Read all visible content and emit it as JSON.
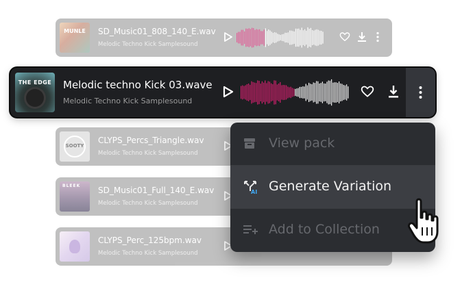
{
  "rows": [
    {
      "title": "SD_Music01_808_140_E.wav",
      "subtitle": "Melodic Techno Kick Samplesound",
      "art_text": "MUNLE"
    },
    {
      "title": "CLYPS_Percs_Triangle.wav",
      "subtitle": "Melodic Techno Kick Samplesound",
      "art_text": "SOOTY"
    },
    {
      "title": "SD_Music01_Full_140_E.wav",
      "subtitle": "Melodic Techno Kick Samplesound",
      "art_text": "BLEEK"
    },
    {
      "title": "CLYPS_Perc_125bpm.wav",
      "subtitle": "Melodic Techno Kick Samplesound",
      "art_text": ""
    }
  ],
  "active_row": {
    "title": "Melodic techno Kick 03.wave",
    "subtitle": "Melodic Techno Kick Samplesound",
    "art_text": "THE EDGE"
  },
  "menu": {
    "items": [
      {
        "label": "View pack",
        "icon": "archive-icon",
        "state": "disabled"
      },
      {
        "label": "Generate Variation",
        "icon": "ai-variation-icon",
        "state": "highlighted"
      },
      {
        "label": "Add to Collection",
        "icon": "playlist-add-icon",
        "state": "disabled"
      }
    ]
  },
  "colors": {
    "waveform_played": "#d6206f",
    "waveform_unplayed": "#ffffff",
    "row_bg": "#a9a9a9",
    "active_bg": "#1e1f22",
    "menu_bg": "#2b2d31"
  },
  "icons": [
    "play-icon",
    "heart-icon",
    "download-icon",
    "more-vertical-icon",
    "hand-pointer-icon"
  ]
}
